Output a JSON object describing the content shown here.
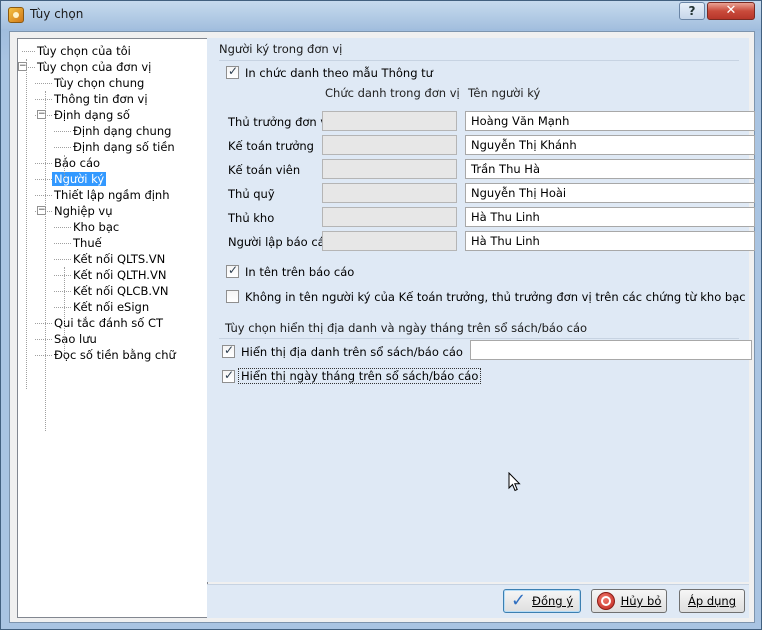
{
  "window": {
    "title": "Tùy chọn",
    "help_label": "?",
    "close_label": "✕"
  },
  "tree": {
    "items": [
      {
        "label": "Tùy chọn của tôi",
        "level": 0
      },
      {
        "label": "Tùy chọn của đơn vị",
        "level": 0,
        "expander": "−"
      },
      {
        "label": "Tùy chọn chung",
        "level": 1
      },
      {
        "label": "Thông tin đơn vị",
        "level": 1
      },
      {
        "label": "Định dạng số",
        "level": 1,
        "expander": "−"
      },
      {
        "label": "Định dạng chung",
        "level": 2
      },
      {
        "label": "Định dạng số tiền",
        "level": 2
      },
      {
        "label": "Báo cáo",
        "level": 1
      },
      {
        "label": "Người ký",
        "level": 1,
        "selected": true
      },
      {
        "label": "Thiết lập ngầm định",
        "level": 1
      },
      {
        "label": "Nghiệp vụ",
        "level": 1,
        "expander": "−"
      },
      {
        "label": "Kho bạc",
        "level": 2
      },
      {
        "label": "Thuế",
        "level": 2
      },
      {
        "label": "Kết nối QLTS.VN",
        "level": 2
      },
      {
        "label": "Kết nối QLTH.VN",
        "level": 2
      },
      {
        "label": "Kết nối QLCB.VN",
        "level": 2
      },
      {
        "label": "Kết nối eSign",
        "level": 2
      },
      {
        "label": "Qui tắc đánh số CT",
        "level": 1
      },
      {
        "label": "Sao lưu",
        "level": 1
      },
      {
        "label": "Đọc số tiền bằng chữ",
        "level": 1
      }
    ]
  },
  "signers": {
    "group_title": "Người ký trong đơn vị",
    "print_title_label": "In chức danh theo mẫu Thông tư",
    "print_title_checked": true,
    "col_title": "Chức danh trong đơn vị",
    "col_name": "Tên người ký",
    "rows": [
      {
        "label": "Thủ trưởng đơn vị",
        "title": "",
        "name": "Hoàng Văn Mạnh"
      },
      {
        "label": "Kế toán trưởng",
        "title": "",
        "name": "Nguyễn Thị Khánh"
      },
      {
        "label": "Kế toán viên",
        "title": "",
        "name": "Trần Thu Hà"
      },
      {
        "label": "Thủ quỹ",
        "title": "",
        "name": "Nguyễn Thị Hoài"
      },
      {
        "label": "Thủ kho",
        "title": "",
        "name": "Hà Thu Linh"
      },
      {
        "label": "Người lập báo cáo",
        "title": "",
        "name": "Hà Thu Linh"
      }
    ],
    "print_name_label": "In tên trên báo cáo",
    "print_name_checked": true,
    "no_print_label": "Không in tên người ký của Kế toán trưởng, thủ trưởng đơn vị trên các chứng từ kho bạc",
    "no_print_checked": false
  },
  "location": {
    "group_title": "Tùy chọn hiển thị địa danh và ngày tháng trên sổ sách/báo cáo",
    "show_place_label": "Hiển thị địa danh trên sổ sách/báo cáo",
    "show_place_checked": true,
    "place_value": "",
    "show_date_label": "Hiển thị ngày tháng trên sổ sách/báo cáo",
    "show_date_checked": true
  },
  "buttons": {
    "ok_label": "Đồng ý",
    "cancel_label": "Hủy bỏ",
    "apply_label": "Áp dụng"
  }
}
